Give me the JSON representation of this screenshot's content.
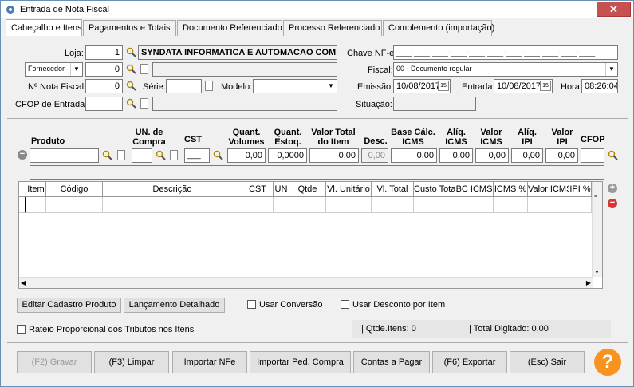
{
  "window": {
    "title": "Entrada de Nota Fiscal",
    "close": "✕"
  },
  "tabs": [
    "Cabeçalho e Itens",
    "Pagamentos e Totais",
    "Documento Referenciado",
    "Processo Referenciado",
    "Complemento (importação)"
  ],
  "header": {
    "loja_label": "Loja:",
    "loja_value": "1",
    "loja_name": "SYNDATA INFORMATICA E AUTOMACAO COMERCI",
    "partner_type": "Fornecedor",
    "partner_value": "0",
    "nf_label": "Nº Nota Fiscal:",
    "nf_value": "0",
    "serie_label": "Série:",
    "modelo_label": "Modelo:",
    "cfop_label": "CFOP de Entrada:",
    "chave_label": "Chave NF-e:",
    "chave_value": "____-____-____-____-____-____-____-____-____-____-____",
    "fiscal_label": "Fiscal:",
    "fiscal_value": "00 - Documento regular",
    "emissao_label": "Emissão:",
    "emissao_value": "10/08/2017",
    "entrada_label": "Entrada:",
    "entrada_value": "10/08/2017",
    "hora_label": "Hora:",
    "hora_value": "08:26:04",
    "situacao_label": "Situação:",
    "cal_icon": "15"
  },
  "item_entry": {
    "produto": "Produto",
    "un_compra": "UN. de\nCompra",
    "cst": "CST",
    "quant_volumes": "Quant.\nVolumes",
    "quant_estoq": "Quant.\nEstoq.",
    "valor_total": "Valor Total\ndo Item",
    "desc": "Desc.",
    "base_icms": "Base Cálc.\nICMS",
    "aliq_icms": "Alíq.\nICMS",
    "valor_icms": "Valor\nICMS",
    "aliq_ipi": "Alíq.\nIPI",
    "valor_ipi": "Valor\nIPI",
    "cfop": "CFOP",
    "cst_value": "___",
    "v_volumes": "0,00",
    "v_estoq": "0,0000",
    "v_total": "0,00",
    "v_desc": "0,00",
    "v_base": "0,00",
    "v_aliq_icms": "0,00",
    "v_icms": "0,00",
    "v_aliq_ipi": "0,00",
    "v_ipi": "0,00"
  },
  "grid": {
    "columns": [
      "Item",
      "Código",
      "Descrição",
      "CST",
      "UN",
      "Qtde",
      "Vl. Unitário",
      "Vl. Total",
      "Custo Total",
      "BC ICMS",
      "ICMS %",
      "Valor ICMS",
      "IPI %"
    ]
  },
  "actions": {
    "editar": "Editar Cadastro Produto",
    "lancamento": "Lançamento Detalhado",
    "usar_conversao": "Usar Conversão",
    "usar_desconto": "Usar Desconto por Item",
    "rateio": "Rateio Proporcional dos Tributos nos Itens"
  },
  "status": {
    "qtde_itens": "| Qtde.Itens: 0",
    "total_digitado": "| Total Digitado: 0,00"
  },
  "footer": [
    "(F2) Gravar",
    "(F3) Limpar",
    "Importar NFe",
    "Importar Ped. Compra",
    "Contas a Pagar",
    "(F6) Exportar",
    "(Esc) Sair"
  ],
  "help": "?"
}
